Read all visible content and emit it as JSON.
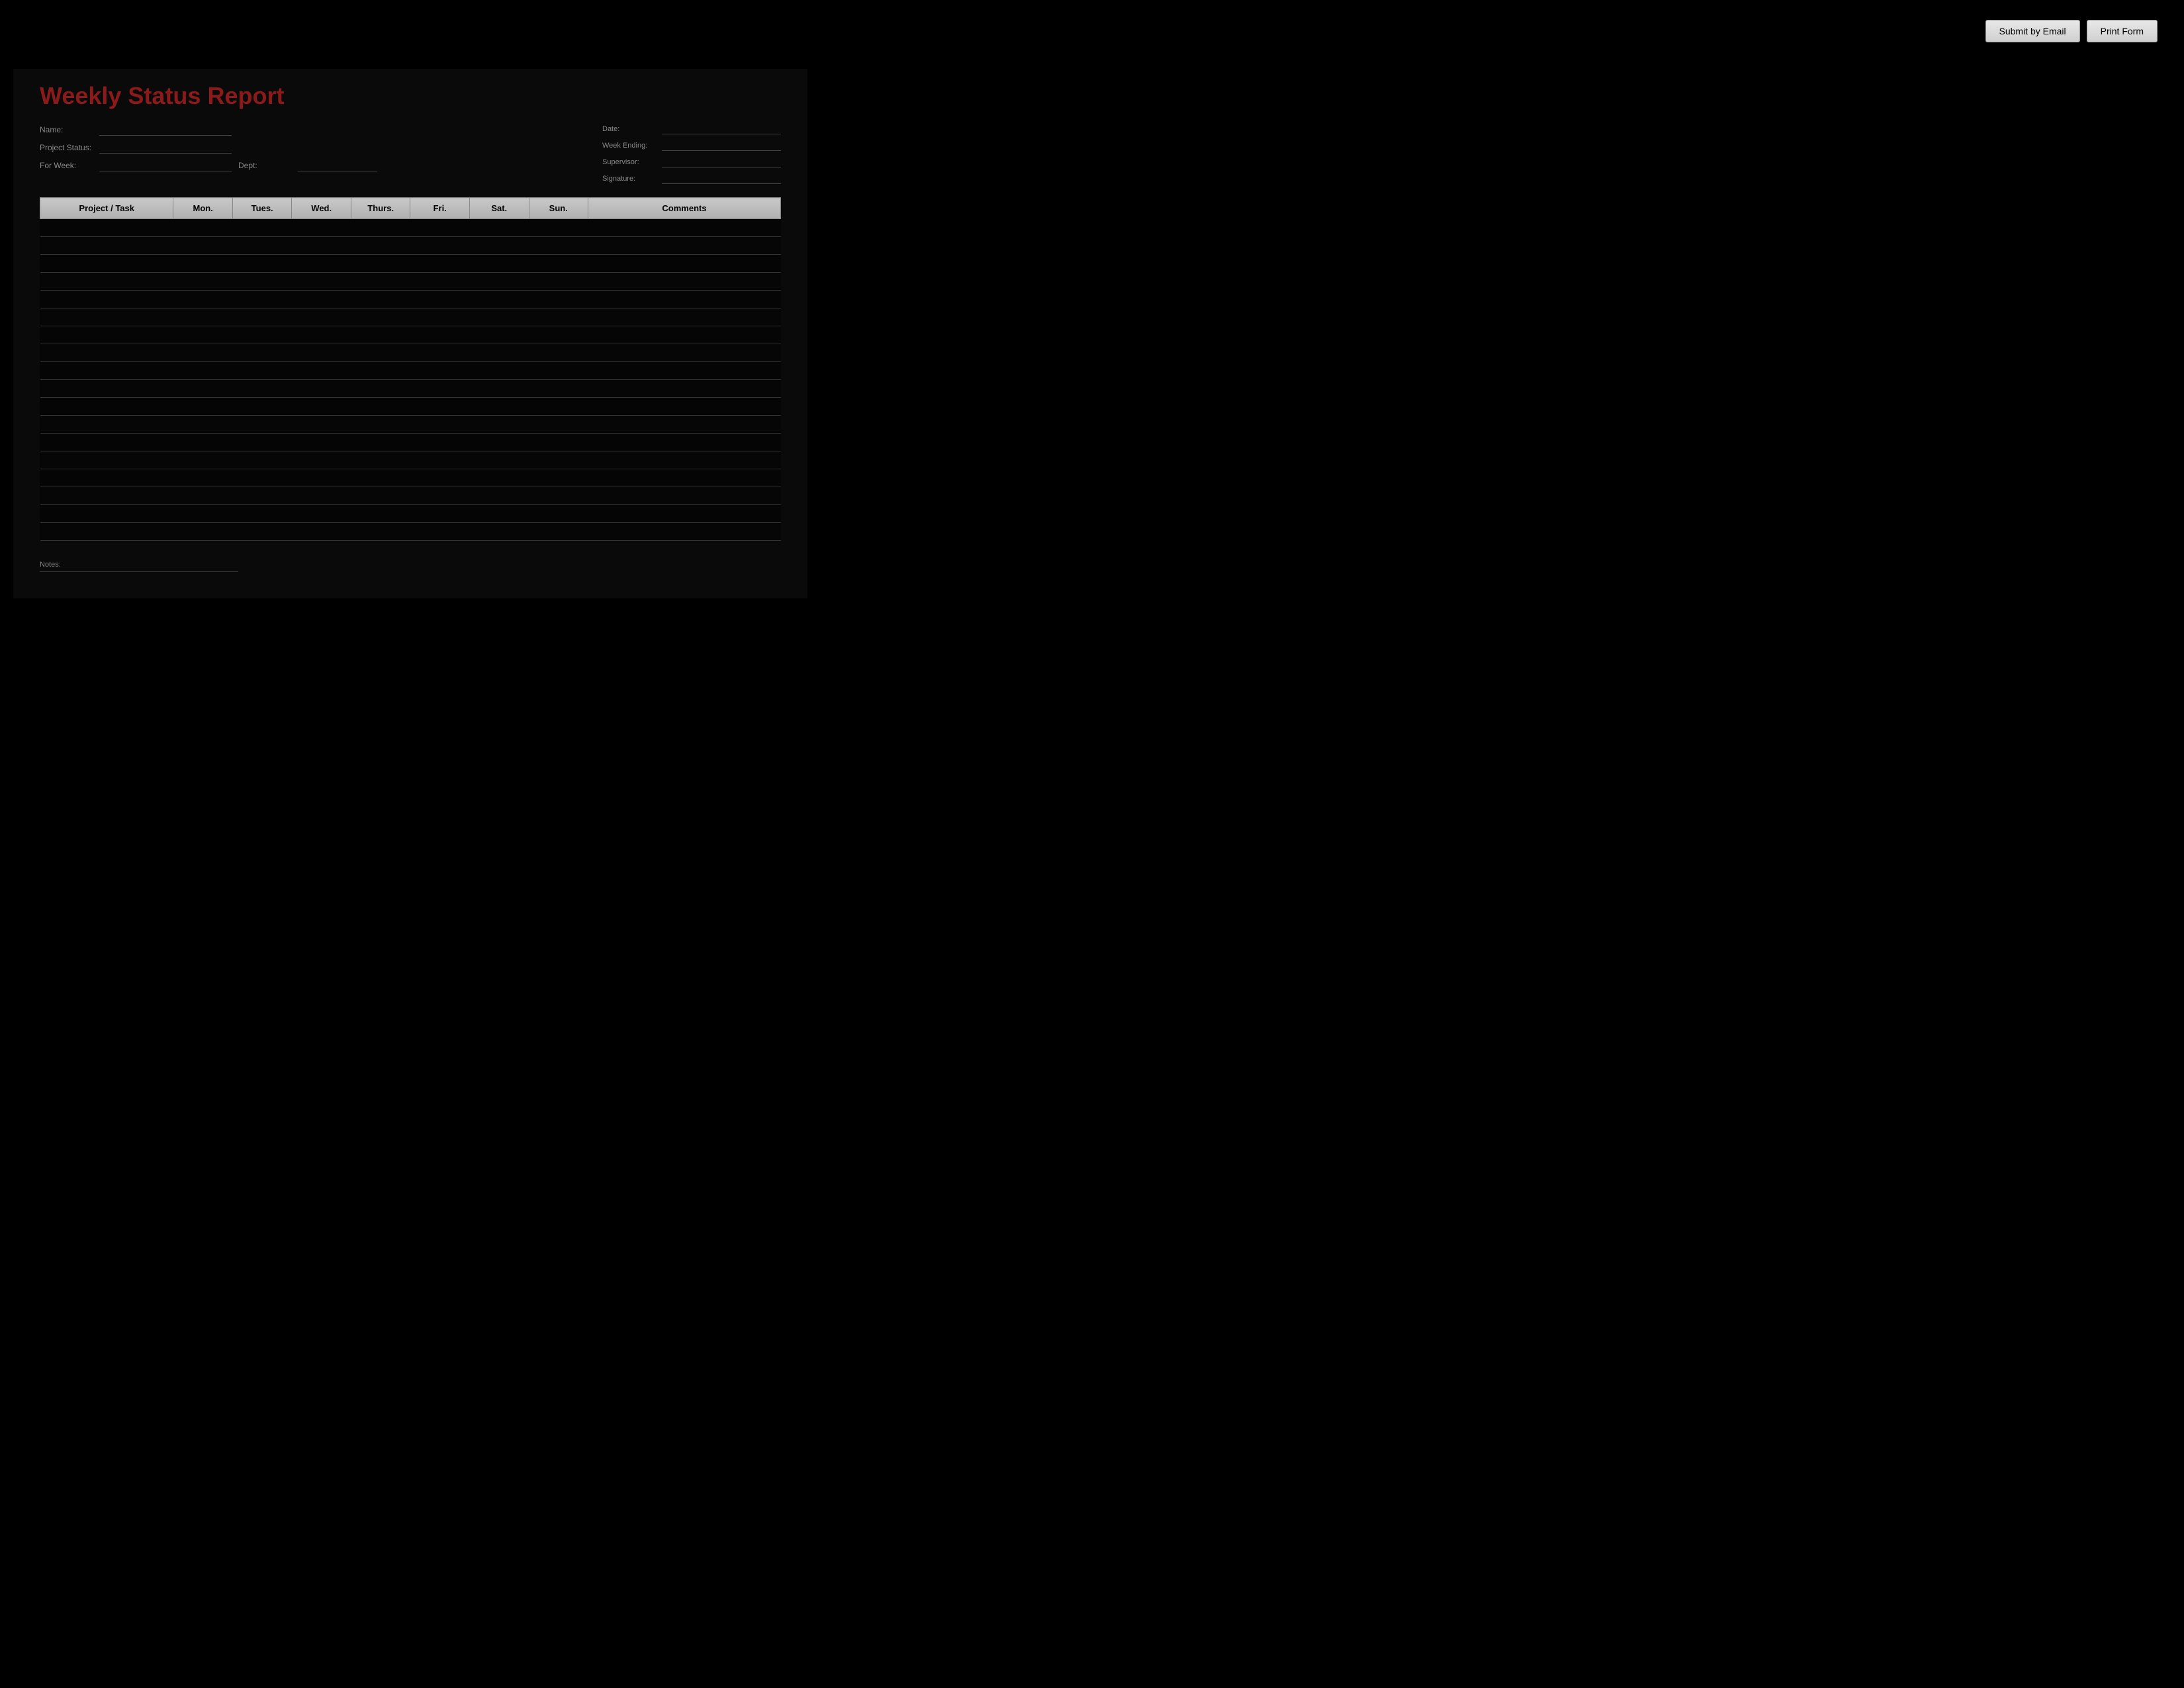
{
  "toolbar": {
    "submit_email_label": "Submit by Email",
    "print_form_label": "Print Form"
  },
  "header": {
    "title": "Weekly Status Report"
  },
  "form": {
    "name_label": "Name:",
    "name_value": "",
    "project_status_label": "Project Status:",
    "project_status_value": "",
    "for_week_label": "For Week:",
    "for_week_value": "",
    "dept_label": "Dept:",
    "dept_value": "",
    "date_label": "Date:",
    "date_value": "",
    "week_ending_label": "Week Ending:",
    "week_ending_value": "",
    "supervisor_label": "Supervisor:",
    "supervisor_value": "",
    "signature_label": "Signature:",
    "signature_value": ""
  },
  "table": {
    "headers": [
      "Project / Task",
      "Mon.",
      "Tues.",
      "Wed.",
      "Thurs.",
      "Fri.",
      "Sat.",
      "Sun.",
      "Comments"
    ],
    "rows": 18
  },
  "footer": {
    "notes_label": "Notes:"
  }
}
